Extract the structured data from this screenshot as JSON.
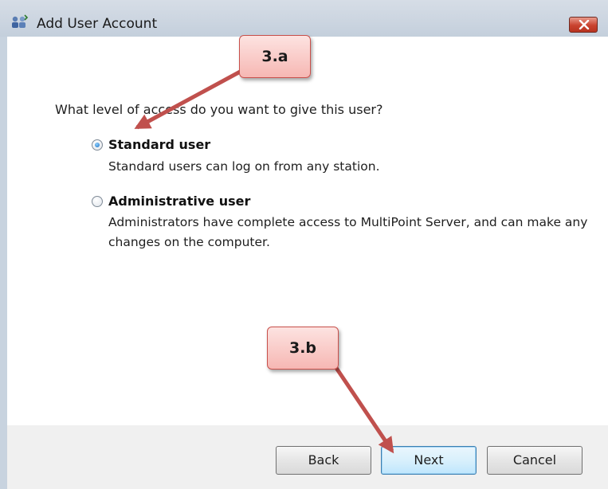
{
  "window": {
    "title": "Add User Account",
    "close_icon": "close-icon"
  },
  "content": {
    "question": "What level of access do you want to give this user?",
    "options": [
      {
        "label": "Standard user",
        "description_lines": [
          "Standard users can log on from any station."
        ],
        "selected": true
      },
      {
        "label": "Administrative user",
        "description_lines": [
          "Administrators have complete access to MultiPoint Server, and can make any",
          "changes on the computer."
        ],
        "selected": false
      }
    ]
  },
  "buttons": {
    "back": "Back",
    "next": "Next",
    "cancel": "Cancel"
  },
  "annotations": {
    "callout_a": "3.a",
    "callout_b": "3.b",
    "callout_color": "#f6b7b3",
    "arrow_color": "#c0504d"
  }
}
